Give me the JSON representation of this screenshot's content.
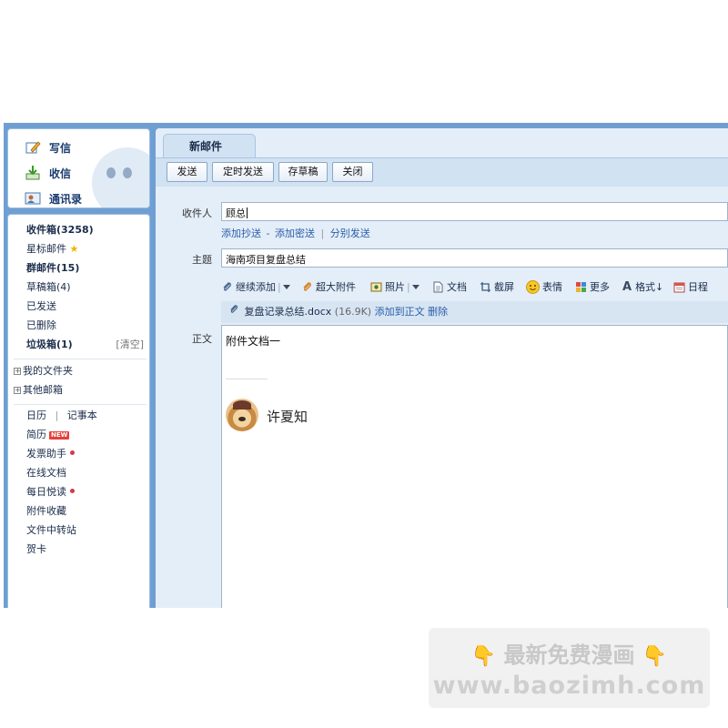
{
  "sidebar": {
    "quick": [
      {
        "label": "写信",
        "icon": "compose-pen-icon"
      },
      {
        "label": "收信",
        "icon": "inbox-download-icon"
      },
      {
        "label": "通讯录",
        "icon": "contacts-card-icon"
      }
    ],
    "folders": {
      "inbox": "收件箱(3258)",
      "starred": "星标邮件",
      "group": "群邮件(15)",
      "drafts": "草稿箱(4)",
      "sent": "已发送",
      "deleted": "已删除",
      "spam": "垃圾箱(1)",
      "clear": "[清空]",
      "my_folders": "我的文件夹",
      "other_mailboxes": "其他邮箱"
    },
    "apps": {
      "calendar": "日历",
      "divider": "|",
      "notepad": "记事本",
      "resume": "简历",
      "resume_badge": "NEW",
      "invoice": "发票助手",
      "online_docs": "在线文档",
      "daily_read": "每日悦读",
      "attachments": "附件收藏",
      "file_transfer": "文件中转站",
      "cards": "贺卡"
    }
  },
  "compose": {
    "tab_label": "新邮件",
    "toolbar": {
      "send": "发送",
      "scheduled_send": "定时发送",
      "save_draft": "存草稿",
      "close": "关闭"
    },
    "recipient_label": "收件人",
    "recipient_value": "顾总",
    "cc_links": {
      "add_cc": "添加抄送",
      "dash": "-",
      "add_bcc": "添加密送",
      "divider": "|",
      "separate_send": "分别发送"
    },
    "subject_label": "主题",
    "subject_value": "海南项目复盘总结",
    "format_toolbar": {
      "continue_add": "继续添加",
      "large_attachment": "超大附件",
      "photo": "照片",
      "document": "文档",
      "screenshot": "截屏",
      "emoji": "表情",
      "more": "更多",
      "format": "格式↓",
      "schedule": "日程"
    },
    "attachment": {
      "file_name": "复盘记录总结.docx",
      "file_size": "(16.9K)",
      "add_to_body": "添加到正文",
      "delete": "删除"
    },
    "body_label": "正文",
    "body_text": "附件文档一",
    "signature_name": "许夏知"
  },
  "watermark": {
    "line1": "最新免费漫画",
    "line2": "www.baozimh.com",
    "color": "#f0a326"
  },
  "colors": {
    "frame_blue": "#6f9fd2",
    "panel_bg": "#e4eef8",
    "link_blue": "#2a5da8"
  }
}
